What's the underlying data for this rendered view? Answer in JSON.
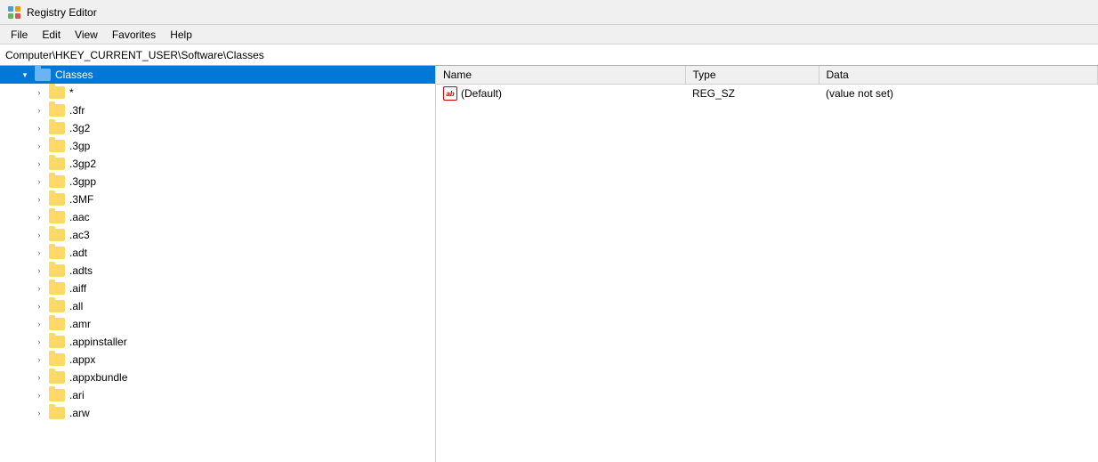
{
  "titleBar": {
    "icon": "registry-editor-icon",
    "title": "Registry Editor"
  },
  "menuBar": {
    "items": [
      "File",
      "Edit",
      "View",
      "Favorites",
      "Help"
    ]
  },
  "addressBar": {
    "path": "Computer\\HKEY_CURRENT_USER\\Software\\Classes"
  },
  "treePanel": {
    "items": [
      {
        "id": "classes",
        "label": "Classes",
        "level": 1,
        "expanded": true,
        "selected": true,
        "hasChildren": true
      },
      {
        "id": "star",
        "label": "*",
        "level": 2,
        "expanded": false,
        "selected": false,
        "hasChildren": true
      },
      {
        "id": "3fr",
        "label": ".3fr",
        "level": 2,
        "expanded": false,
        "selected": false,
        "hasChildren": true
      },
      {
        "id": "3g2",
        "label": ".3g2",
        "level": 2,
        "expanded": false,
        "selected": false,
        "hasChildren": true
      },
      {
        "id": "3gp",
        "label": ".3gp",
        "level": 2,
        "expanded": false,
        "selected": false,
        "hasChildren": true
      },
      {
        "id": "3gp2",
        "label": ".3gp2",
        "level": 2,
        "expanded": false,
        "selected": false,
        "hasChildren": true
      },
      {
        "id": "3gpp",
        "label": ".3gpp",
        "level": 2,
        "expanded": false,
        "selected": false,
        "hasChildren": true
      },
      {
        "id": "3MF",
        "label": ".3MF",
        "level": 2,
        "expanded": false,
        "selected": false,
        "hasChildren": true
      },
      {
        "id": "aac",
        "label": ".aac",
        "level": 2,
        "expanded": false,
        "selected": false,
        "hasChildren": true
      },
      {
        "id": "ac3",
        "label": ".ac3",
        "level": 2,
        "expanded": false,
        "selected": false,
        "hasChildren": true
      },
      {
        "id": "adt",
        "label": ".adt",
        "level": 2,
        "expanded": false,
        "selected": false,
        "hasChildren": true
      },
      {
        "id": "adts",
        "label": ".adts",
        "level": 2,
        "expanded": false,
        "selected": false,
        "hasChildren": true
      },
      {
        "id": "aiff",
        "label": ".aiff",
        "level": 2,
        "expanded": false,
        "selected": false,
        "hasChildren": true
      },
      {
        "id": "all",
        "label": ".all",
        "level": 2,
        "expanded": false,
        "selected": false,
        "hasChildren": true
      },
      {
        "id": "amr",
        "label": ".amr",
        "level": 2,
        "expanded": false,
        "selected": false,
        "hasChildren": true
      },
      {
        "id": "appinstaller",
        "label": ".appinstaller",
        "level": 2,
        "expanded": false,
        "selected": false,
        "hasChildren": true
      },
      {
        "id": "appx",
        "label": ".appx",
        "level": 2,
        "expanded": false,
        "selected": false,
        "hasChildren": true
      },
      {
        "id": "appxbundle",
        "label": ".appxbundle",
        "level": 2,
        "expanded": false,
        "selected": false,
        "hasChildren": true
      },
      {
        "id": "ari",
        "label": ".ari",
        "level": 2,
        "expanded": false,
        "selected": false,
        "hasChildren": true
      },
      {
        "id": "arw",
        "label": ".arw",
        "level": 2,
        "expanded": false,
        "selected": false,
        "hasChildren": true
      }
    ]
  },
  "detailPanel": {
    "columns": [
      {
        "id": "name",
        "label": "Name"
      },
      {
        "id": "type",
        "label": "Type"
      },
      {
        "id": "data",
        "label": "Data"
      }
    ],
    "rows": [
      {
        "name": "(Default)",
        "type": "REG_SZ",
        "data": "(value not set)",
        "icon": "ab"
      }
    ]
  }
}
